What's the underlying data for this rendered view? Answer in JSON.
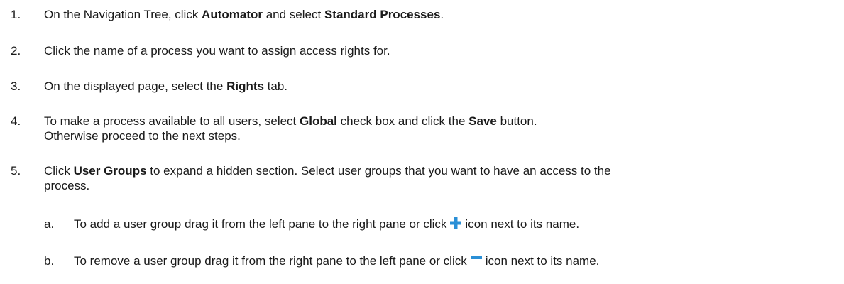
{
  "steps": [
    {
      "num": "1.",
      "parts": [
        "On the Navigation Tree, click ",
        "Automator",
        " and select ",
        "Standard Processes",
        "."
      ]
    },
    {
      "num": "2.",
      "parts": [
        "Click the name of a process you want to assign access rights for."
      ]
    },
    {
      "num": "3.",
      "parts": [
        "On the displayed page, select the ",
        "Rights",
        " tab."
      ]
    },
    {
      "num": "4.",
      "parts": [
        "To make a process available to all users, select ",
        "Global",
        " check box and click the ",
        "Save",
        " button."
      ],
      "line2": "Otherwise proceed to the next steps."
    },
    {
      "num": "5.",
      "parts": [
        "Click ",
        "User Groups",
        " to expand a hidden section. Select user groups that you want to have an access to the"
      ],
      "line2": "process."
    }
  ],
  "substeps": [
    {
      "num": "a.",
      "before": "To add a user group drag it from the left pane to the right pane or click",
      "icon": "plus-icon",
      "after": "icon next to its name."
    },
    {
      "num": "b.",
      "before": "To remove a user group drag it from the right pane to the left  pane or click",
      "icon": "minus-icon",
      "after": "icon next to its name."
    }
  ],
  "colors": {
    "text": "#1a1a1a",
    "icon": "#2a8fd6"
  }
}
